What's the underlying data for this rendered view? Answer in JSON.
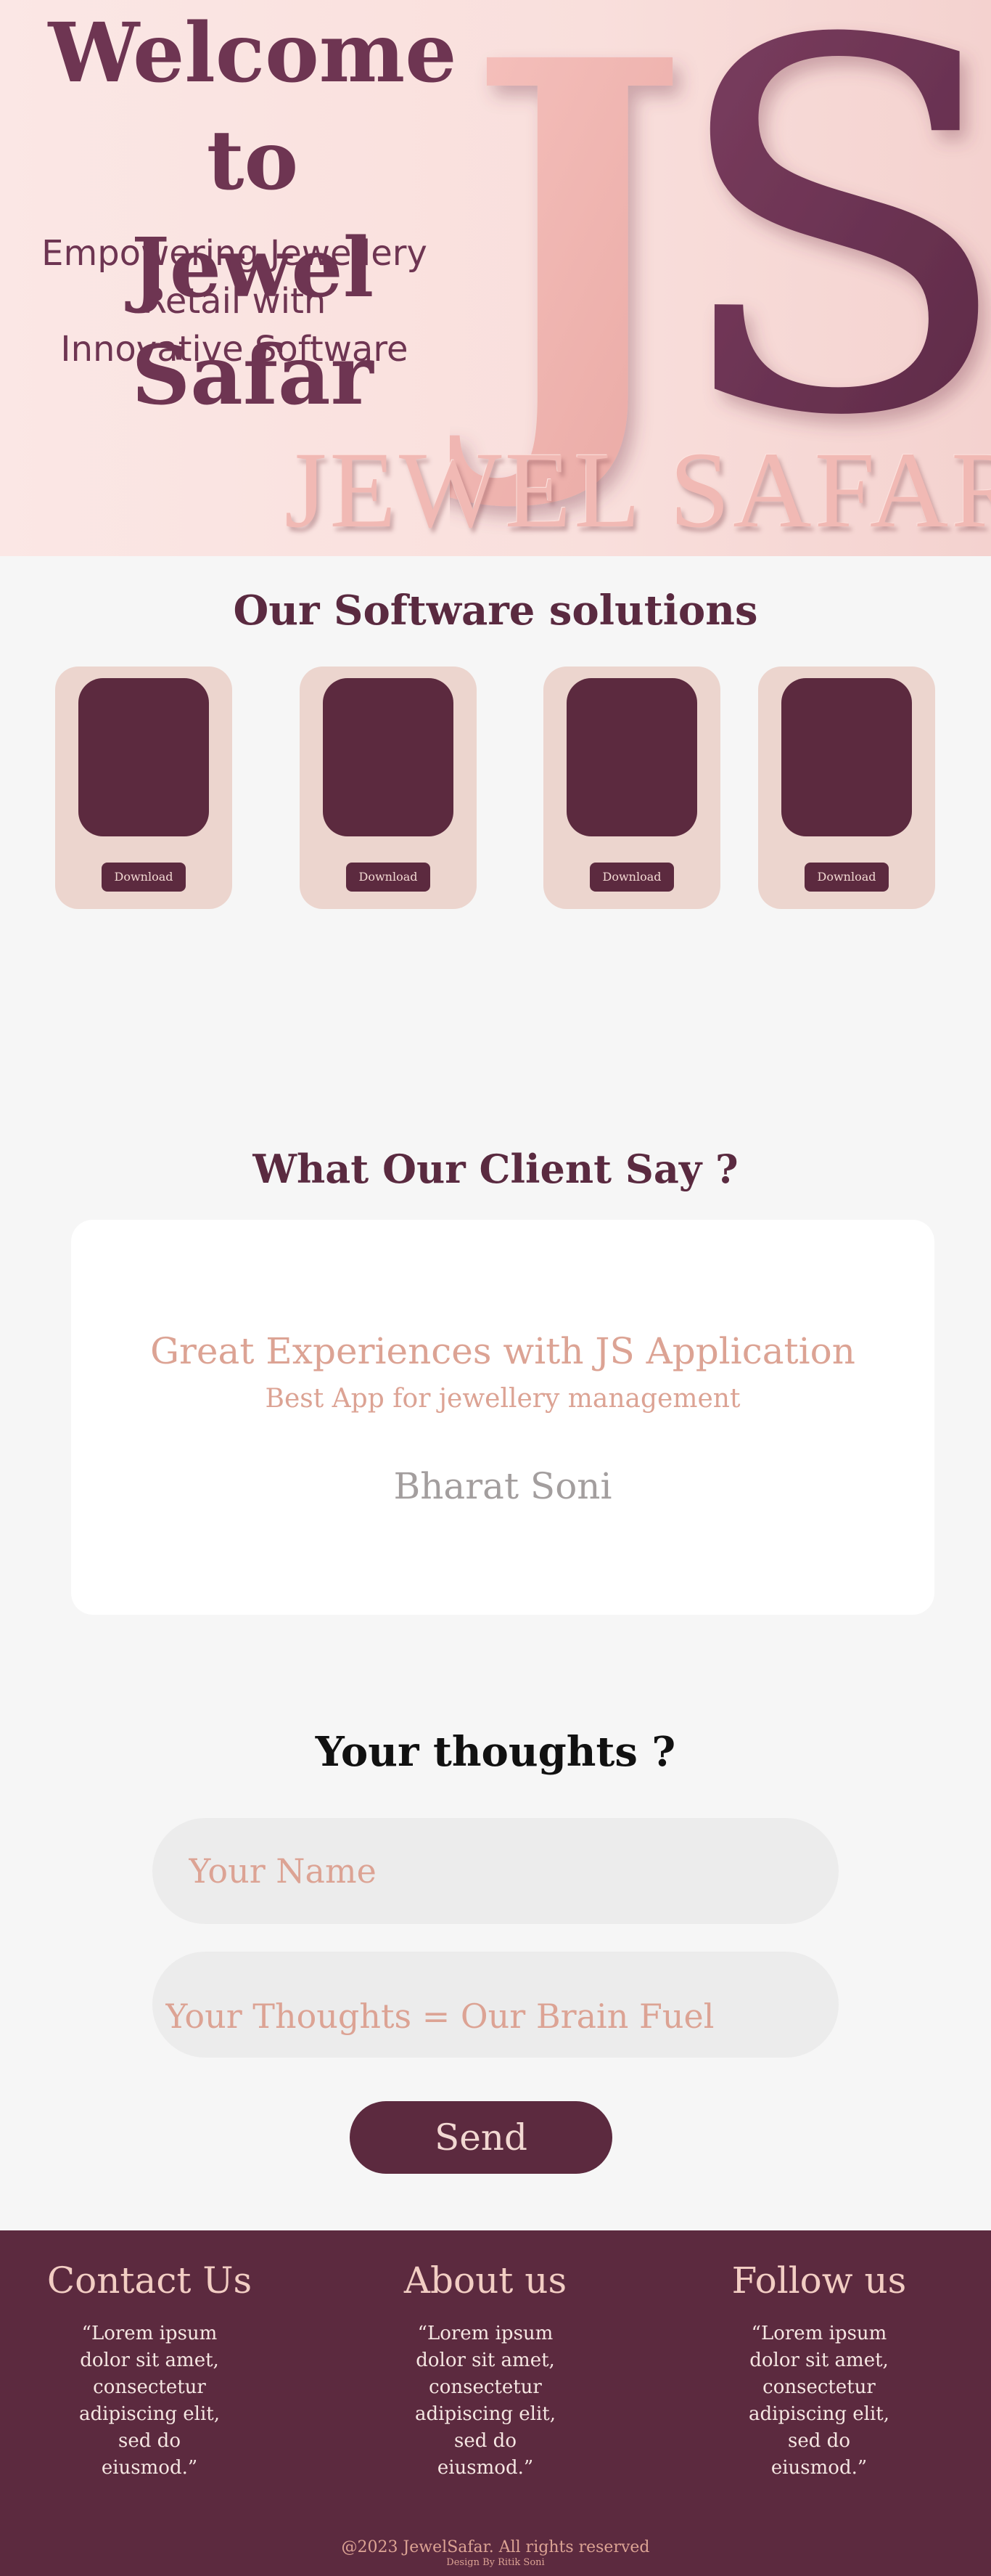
{
  "colors": {
    "plum": "#5c2a3f",
    "rose": "#dca394",
    "card_bg": "#ecd5ce",
    "page_bg": "#f6f6f6"
  },
  "hero": {
    "title_line1": "Welcome to",
    "title_line2": "Jewel Safar",
    "subtitle_line1": "Empowering Jewellery",
    "subtitle_line2": "Retail with",
    "subtitle_line3": "Innovative Software",
    "logo_text": "JS",
    "brand_text": "JEWEL SAFAR"
  },
  "software": {
    "title": "Our Software solutions",
    "cards": [
      {
        "button": "Download"
      },
      {
        "button": "Download"
      },
      {
        "button": "Download"
      },
      {
        "button": "Download"
      }
    ]
  },
  "testimonials": {
    "title": "What Our Client Say ?",
    "heading": "Great Experiences with JS Application",
    "subheading": "Best App for jewellery management",
    "author": "Bharat Soni"
  },
  "feedback_form": {
    "title": "Your thoughts ?",
    "name_placeholder": "Your Name",
    "thoughts_placeholder": "Your Thoughts = Our Brain Fuel",
    "send_label": "Send"
  },
  "footer": {
    "contact": {
      "title": "Contact Us",
      "text": "“Lorem ipsum dolor sit amet, consectetur adipiscing elit, sed do eiusmod.”"
    },
    "about": {
      "title": "About us",
      "text": "“Lorem ipsum dolor sit amet, consectetur adipiscing elit, sed do eiusmod.”"
    },
    "follow": {
      "title": "Follow us",
      "text": "“Lorem ipsum dolor sit amet, consectetur adipiscing elit, sed do eiusmod.”"
    },
    "copyright": "@2023 JewelSafar. All rights reserved",
    "design_by": "Design By Ritik Soni"
  }
}
